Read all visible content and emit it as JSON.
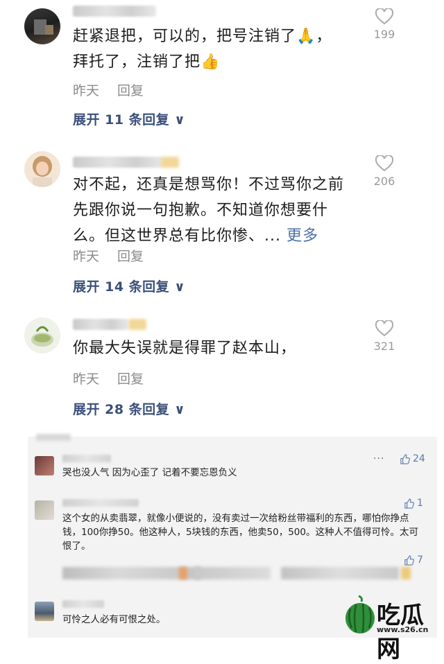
{
  "comments": [
    {
      "text_lines": [
        "赶紧退把，可以的，把号注销了🙏，",
        "拜托了，注销了把👍"
      ],
      "time": "昨天",
      "reply": "回复",
      "expand": "展开 11 条回复 ∨",
      "likes": "199"
    },
    {
      "text_lines": [
        "对不起，还真是想骂你！不过骂你之前",
        "先跟你说一句抱歉。不知道你想要什",
        "么。但这世界总有比你惨、..."
      ],
      "more": "更多",
      "time": "昨天",
      "reply": "回复",
      "expand": "展开 14 条回复 ∨",
      "likes": "206"
    },
    {
      "text_lines": [
        "你最大失误就是得罪了赵本山，"
      ],
      "time": "昨天",
      "reply": "回复",
      "expand": "展开 28 条回复 ∨",
      "likes": "321"
    }
  ],
  "wechat_comments": [
    {
      "text": "哭也没人气 因为心歪了 记着不要忘恩负义",
      "likes": "24",
      "menu": "···"
    },
    {
      "text": "这个女的从卖翡翠，就像小便说的，没有卖过一次给粉丝带福利的东西，哪怕你挣点钱，100你挣50。他这种人，5块钱的东西，他卖50，500。这种人不值得可怜。太可恨了。",
      "likes": "1"
    },
    {
      "text": "",
      "likes": "7"
    },
    {
      "text": "可怜之人必有可恨之处。",
      "likes": ""
    }
  ],
  "watermark": {
    "text": "吃瓜网",
    "url": "www.s26.cn"
  }
}
